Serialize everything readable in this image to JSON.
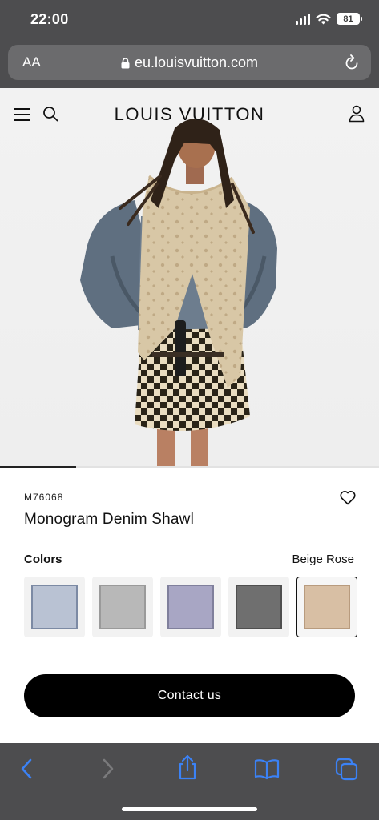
{
  "status_bar": {
    "time": "22:00",
    "battery": "81"
  },
  "browser": {
    "text_size_label": "AA",
    "url": "eu.louisvuitton.com"
  },
  "site": {
    "brand": "LOUIS VUITTON"
  },
  "product": {
    "sku": "M76068",
    "name": "Monogram Denim Shawl",
    "colors_label": "Colors",
    "selected_color": "Beige Rose",
    "swatches": [
      {
        "color": "#b9c2d3",
        "border": "#7c8aa4"
      },
      {
        "color": "#b8b8b8",
        "border": "#9a9a9a"
      },
      {
        "color": "#a8a6c4",
        "border": "#80809c"
      },
      {
        "color": "#6f6f6f",
        "border": "#4f4f4f"
      },
      {
        "color": "#d8bfa4",
        "border": "#b89b7e"
      }
    ],
    "contact_label": "Contact us"
  },
  "carousel": {
    "current_slide_fraction": 0.2
  },
  "icons": {
    "menu": "hamburger-icon",
    "search": "search-icon",
    "account": "account-icon",
    "wishlist": "heart-icon",
    "back": "back-icon",
    "forward": "forward-icon",
    "share": "share-icon",
    "bookmarks": "bookmarks-icon",
    "tabs": "tabs-icon",
    "lock": "lock-icon",
    "reload": "reload-icon"
  },
  "colors": {
    "browser_chrome": "#4d4d4f",
    "accent_blue": "#3b82f6",
    "button_black": "#000000"
  }
}
